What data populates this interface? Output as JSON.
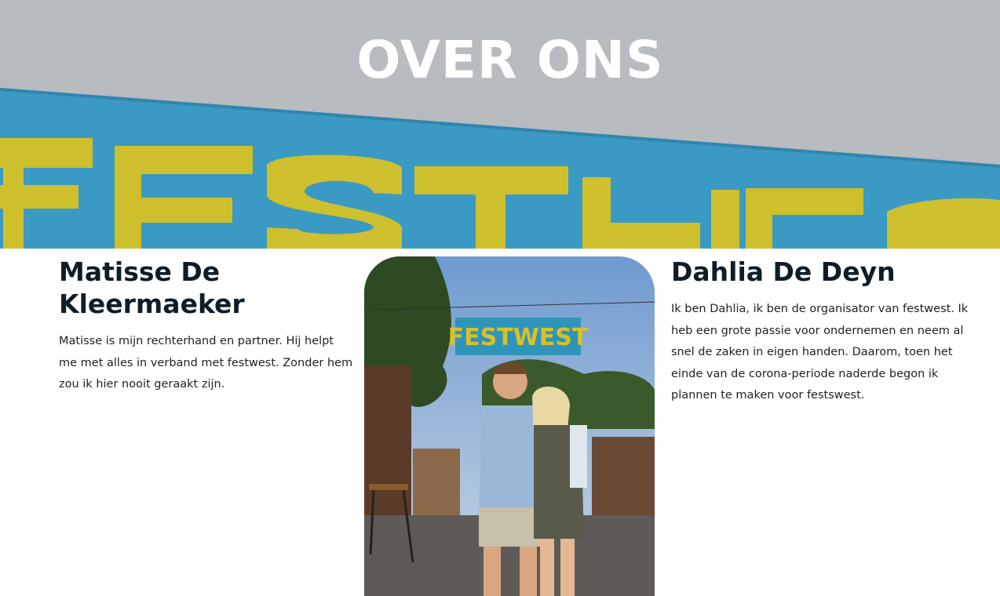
{
  "hero": {
    "title": "OVER ONS",
    "banner_text": "FESTWEST"
  },
  "photo": {
    "sign_text": "FESTWEST"
  },
  "people": [
    {
      "name": "Matisse De Kleermaeker",
      "bio": "Matisse is mijn rechterhand en partner. Hij helpt me met alles in verband met festwest. Zonder hem zou ik hier nooit geraakt zijn."
    },
    {
      "name": "Dahlia De Deyn",
      "bio": "Ik ben Dahlia, ik ben de organisator van festwest. Ik heb een grote passie voor ondernemen en neem al snel de zaken in eigen handen. Daarom, toen het einde van de corona-periode naderde begon ik plannen te maken voor festswest."
    }
  ],
  "colors": {
    "sky_gray": "#b9bcc1",
    "banner_blue": "#3d9cc4",
    "banner_yellow": "#d8c128",
    "heading": "#0f1d27"
  }
}
